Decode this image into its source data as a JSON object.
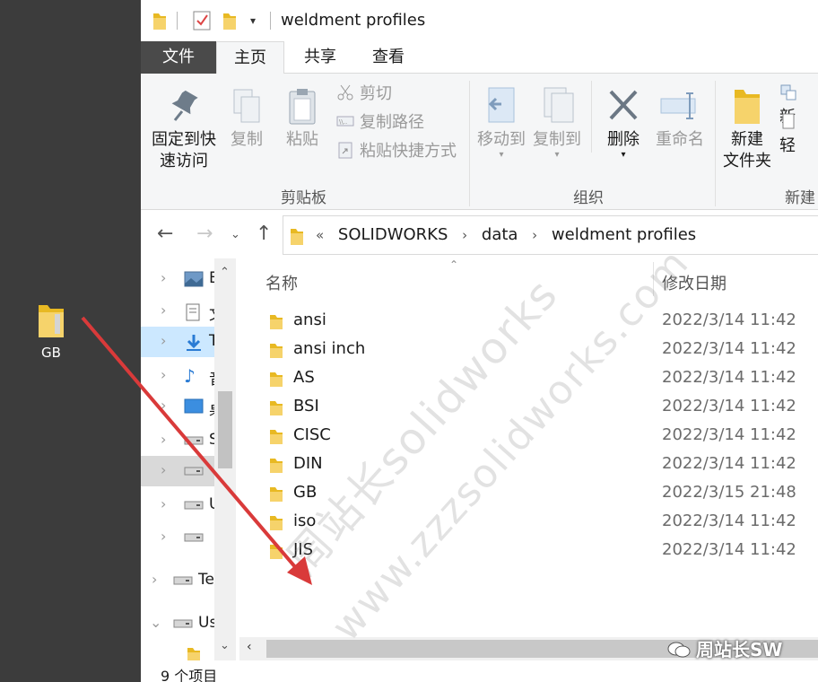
{
  "desktop": {
    "folder_label": "GB"
  },
  "window": {
    "title": "weldment profiles",
    "tabs": [
      "文件",
      "主页",
      "共享",
      "查看"
    ],
    "ribbon": {
      "clipboard": {
        "pin_line1": "固定到快",
        "pin_line2": "速访问",
        "copy": "复制",
        "paste": "粘贴",
        "cut": "剪切",
        "copy_path": "复制路径",
        "paste_shortcut": "粘贴快捷方式",
        "group_label": "剪贴板"
      },
      "organize": {
        "move_to": "移动到",
        "copy_to": "复制到",
        "delete": "删除",
        "rename": "重命名",
        "group_label": "组织"
      },
      "new": {
        "new_folder_line1": "新建",
        "new_folder_line2": "文件夹",
        "new_item": "新",
        "easy_access": "轻",
        "group_label": "新建"
      }
    },
    "address": {
      "overflow": "«",
      "crumbs": [
        "SOLIDWORKS",
        "data",
        "weldment profiles"
      ]
    },
    "nav_items": [
      {
        "label": "E",
        "icon": "image-icon"
      },
      {
        "label": "文",
        "icon": "document-icon"
      },
      {
        "label": "T",
        "icon": "download-icon"
      },
      {
        "label": "音",
        "icon": "music-icon"
      },
      {
        "label": "桌",
        "icon": "desktop-icon"
      },
      {
        "label": "S",
        "icon": "drive-icon"
      },
      {
        "label": "",
        "icon": "drive-icon"
      },
      {
        "label": "U",
        "icon": "drive-icon"
      },
      {
        "label": "",
        "icon": "drive-icon"
      },
      {
        "label": "Te",
        "icon": "drive-icon"
      },
      {
        "label": "Us",
        "icon": "drive-icon"
      },
      {
        "label": "",
        "icon": "folder-icon"
      }
    ],
    "columns": {
      "name": "名称",
      "date": "修改日期"
    },
    "files": [
      {
        "name": "ansi",
        "date": "2022/3/14 11:42"
      },
      {
        "name": "ansi inch",
        "date": "2022/3/14 11:42"
      },
      {
        "name": "AS",
        "date": "2022/3/14 11:42"
      },
      {
        "name": "BSI",
        "date": "2022/3/14 11:42"
      },
      {
        "name": "CISC",
        "date": "2022/3/14 11:42"
      },
      {
        "name": "DIN",
        "date": "2022/3/14 11:42"
      },
      {
        "name": "GB",
        "date": "2022/3/15 21:48"
      },
      {
        "name": "iso",
        "date": "2022/3/14 11:42"
      },
      {
        "name": "JIS",
        "date": "2022/3/14 11:42"
      }
    ],
    "status": "9 个项目"
  },
  "overlay": {
    "watermark_line1": "周站长solidworks",
    "watermark_line2": "www.zzzsolidworks.com",
    "credit": "周站长SW",
    "arrow_color": "#d93a3a"
  }
}
